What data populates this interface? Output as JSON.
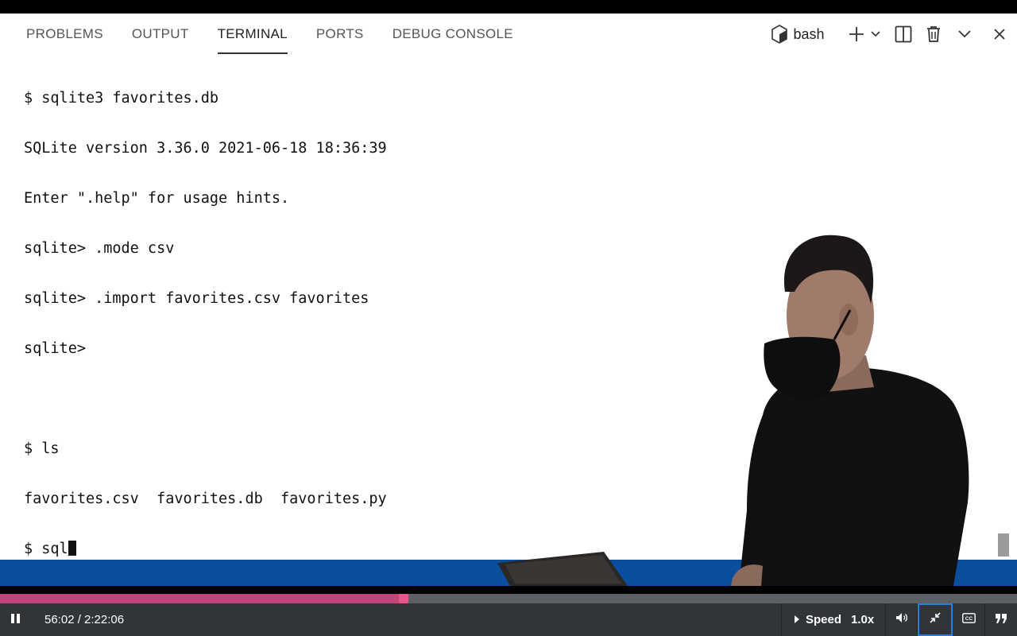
{
  "panel": {
    "tabs": [
      {
        "label": "PROBLEMS",
        "active": false
      },
      {
        "label": "OUTPUT",
        "active": false
      },
      {
        "label": "TERMINAL",
        "active": true
      },
      {
        "label": "PORTS",
        "active": false
      },
      {
        "label": "DEBUG CONSOLE",
        "active": false
      }
    ],
    "shell": {
      "icon": "terminal-shell-icon",
      "label": "bash"
    },
    "actions": [
      "new-terminal-icon",
      "dropdown-chevron-icon",
      "split-terminal-icon",
      "trash-icon",
      "collapse-chevron-icon",
      "close-icon"
    ]
  },
  "terminal": {
    "lines": [
      "$ sqlite3 favorites.db",
      "SQLite version 3.36.0 2021-06-18 18:36:39",
      "Enter \".help\" for usage hints.",
      "sqlite> .mode csv",
      "sqlite> .import favorites.csv favorites",
      "sqlite>",
      "",
      "$ ls",
      "favorites.csv  favorites.db  favorites.py"
    ],
    "current_input": "$ sql"
  },
  "player": {
    "progress_fraction": 0.397,
    "time_display": "56:02 / 2:22:06",
    "speed_label": "Speed",
    "speed_value": "1.0x",
    "colors": {
      "progress": "#c0457a",
      "controls_bg": "#313539",
      "band": "#0a4f9e"
    },
    "icons": [
      "pause-icon",
      "speed-caret-icon",
      "volume-icon",
      "exit-fullscreen-icon",
      "closed-captions-icon",
      "transcript-quote-icon"
    ]
  }
}
